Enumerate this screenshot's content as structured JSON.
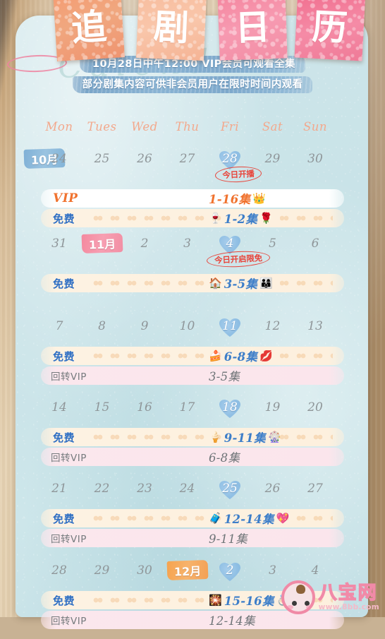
{
  "title_cards": [
    {
      "char": "追",
      "color": "#f0a07a"
    },
    {
      "char": "剧",
      "color": "#f9c3a6"
    },
    {
      "char": "日",
      "color": "#f693ab"
    },
    {
      "char": "历",
      "color": "#f27e9a"
    }
  ],
  "script_watermark": "Calendar",
  "banner": {
    "line1": "10月28日中午12:00 VIP会员可观看全集",
    "line2": "部分剧集内容可供非会员用户在限时时间内观看",
    "circled_date": "10月28日",
    "bg_color": "#85b0d0",
    "circle_color": "#ee82a0"
  },
  "weekdays": [
    "Mon",
    "Tues",
    "Wed",
    "Thu",
    "Fri",
    "Sat",
    "Sun"
  ],
  "labels": {
    "vip": "VIP",
    "free": "免费",
    "huizhuan_vip": "回转VIP"
  },
  "colors": {
    "paper": "#cde6ea",
    "vip_text": "#f0722e",
    "free_text": "#2f6fc4",
    "hui_text": "#767b7e",
    "weekday": "#f3a88c",
    "daynum": "#8f9699",
    "highlight": "#8dbde4",
    "note": "#e8443a"
  },
  "weeks": [
    {
      "month_badge": {
        "label": "10月",
        "style": "blue",
        "slot": -1
      },
      "days": [
        "24",
        "25",
        "26",
        "27",
        "28",
        "29",
        "30"
      ],
      "highlight_index": 4,
      "note": {
        "text": "今日开播",
        "index": 4
      },
      "bars": [
        {
          "type": "vip",
          "label": "VIP",
          "episodes": "1-16集",
          "emoji_before": "",
          "emoji_after": "👑",
          "index": 4
        },
        {
          "type": "free",
          "label": "免费",
          "episodes": "1-2集",
          "emoji_before": "🍷",
          "emoji_after": "🌹",
          "index": 4
        }
      ]
    },
    {
      "month_badge": {
        "label": "11月",
        "style": "pink",
        "slot": 1
      },
      "days": [
        "31",
        "",
        "2",
        "3",
        "4",
        "5",
        "6"
      ],
      "highlight_index": 4,
      "note": {
        "text": "今日开启限免",
        "index": 4
      },
      "bars": [
        {
          "type": "free",
          "label": "免费",
          "episodes": "3-5集",
          "emoji_before": "🏠",
          "emoji_after": "👨‍👩‍👦",
          "index": 4
        }
      ]
    },
    {
      "month_badge": null,
      "days": [
        "7",
        "8",
        "9",
        "10",
        "11",
        "12",
        "13"
      ],
      "highlight_index": 4,
      "note": null,
      "bars": [
        {
          "type": "free",
          "label": "免费",
          "episodes": "6-8集",
          "emoji_before": "🍰",
          "emoji_after": "💋",
          "index": 4
        },
        {
          "type": "hui",
          "label": "回转VIP",
          "episodes": "3-5集",
          "emoji_before": "",
          "emoji_after": "",
          "index": 4
        }
      ]
    },
    {
      "month_badge": null,
      "days": [
        "14",
        "15",
        "16",
        "17",
        "18",
        "19",
        "20"
      ],
      "highlight_index": 4,
      "note": null,
      "bars": [
        {
          "type": "free",
          "label": "免费",
          "episodes": "9-11集",
          "emoji_before": "🍦",
          "emoji_after": "🎡",
          "index": 4
        },
        {
          "type": "hui",
          "label": "回转VIP",
          "episodes": "6-8集",
          "emoji_before": "",
          "emoji_after": "",
          "index": 4
        }
      ]
    },
    {
      "month_badge": null,
      "days": [
        "21",
        "22",
        "23",
        "24",
        "25",
        "26",
        "27"
      ],
      "highlight_index": 4,
      "note": null,
      "bars": [
        {
          "type": "free",
          "label": "免费",
          "episodes": "12-14集",
          "emoji_before": "🧳",
          "emoji_after": "💖",
          "index": 4
        },
        {
          "type": "hui",
          "label": "回转VIP",
          "episodes": "9-11集",
          "emoji_before": "",
          "emoji_after": "",
          "index": 4
        }
      ]
    },
    {
      "month_badge": {
        "label": "12月",
        "style": "orange",
        "slot": 3
      },
      "days": [
        "28",
        "29",
        "30",
        "",
        "2",
        "3",
        "4"
      ],
      "highlight_index": 4,
      "note": null,
      "bars": [
        {
          "type": "free",
          "label": "免费",
          "episodes": "15-16集",
          "emoji_before": "🎇",
          "emoji_after": "💍",
          "index": 4
        },
        {
          "type": "hui",
          "label": "回转VIP",
          "episodes": "12-14集",
          "emoji_before": "",
          "emoji_after": "",
          "index": 4
        }
      ]
    }
  ],
  "watermark": {
    "cn": "八宝网",
    "url": "www.8bb.com"
  }
}
